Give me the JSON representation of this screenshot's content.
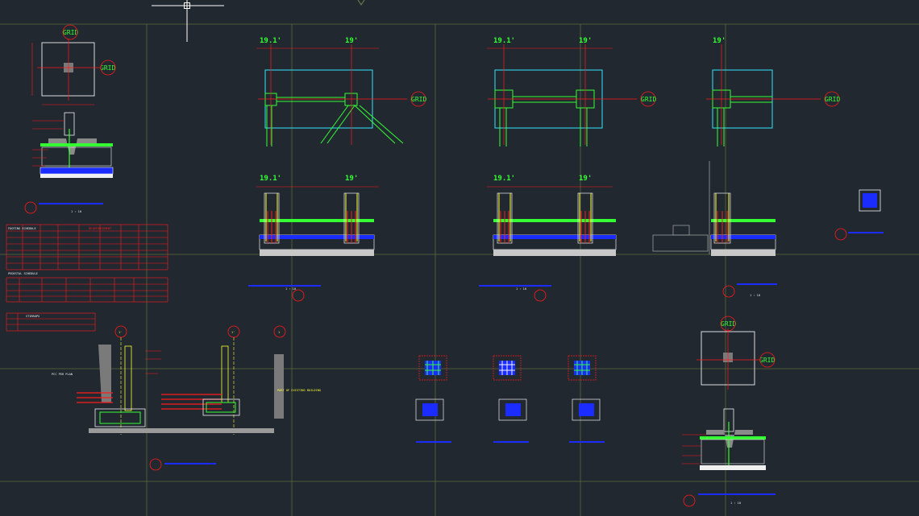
{
  "colors": {
    "background": "#212830",
    "grid_line": "#5a6b3a",
    "red": "#ff1a1a",
    "green": "#33ff33",
    "cyan": "#33e6ff",
    "yellow": "#ffff33",
    "blue": "#1a2cff",
    "white": "#f0f0f0",
    "grey": "#9a9a9a"
  },
  "dims": {
    "plan_a_left": "19.1'",
    "plan_a_right": "19'",
    "plan_b_left": "19.1'",
    "plan_b_right": "19'",
    "plan_c": "19'",
    "elev_a_left": "19.1'",
    "elev_a_right": "19'",
    "elev_b_left": "19.1'",
    "elev_b_right": "19'"
  },
  "grid_labels": {
    "plan_a": "GRID",
    "plan_b": "GRID",
    "plan_c": "GRID",
    "detail_top_top": "GRID",
    "detail_top_right": "GRID",
    "detail_bottom_top": "GRID",
    "detail_bottom_right": "GRID"
  },
  "section_notes": {
    "part_of_existing_building": "PART OF EXISTING BUILDING",
    "pcc_per_plan": "PCC PER PLAN"
  },
  "bubbles": {
    "ftg_section_1": "1'",
    "ftg_section_2": "1'",
    "ftg_section_3": "1"
  },
  "scale_labels": {
    "s1": "1 : 10",
    "s2": "1 : 10",
    "s3": "1 : 10",
    "s4": "1 : 10",
    "s5": "1 : 10"
  },
  "tables": {
    "footing_schedule_title": "FOOTING SCHEDULE",
    "pedestal_schedule_title": "PEDESTAL SCHEDULE",
    "stirrups_title": "STIRRUPS",
    "reinforcement_header": "REINFORCEMENT"
  }
}
